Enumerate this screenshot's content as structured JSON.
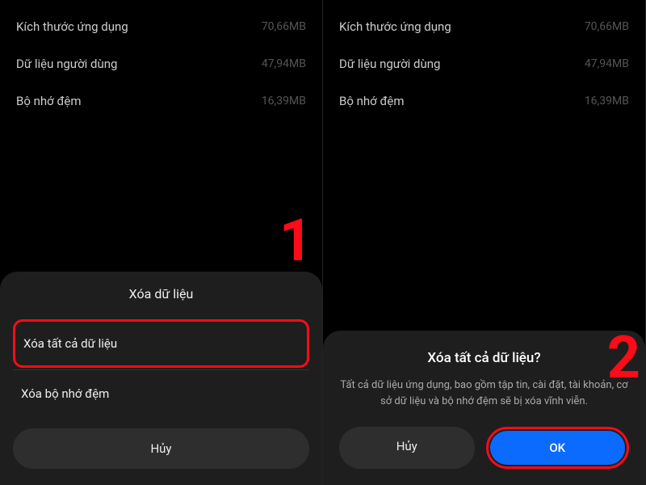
{
  "storage": {
    "rows": [
      {
        "label": "Kích thước ứng dụng",
        "value": "70,66MB"
      },
      {
        "label": "Dữ liệu người dùng",
        "value": "47,94MB"
      },
      {
        "label": "Bộ nhớ đệm",
        "value": "16,39MB"
      }
    ]
  },
  "pane1": {
    "sheet_title": "Xóa dữ liệu",
    "option_clear_all": "Xóa tất cả dữ liệu",
    "option_clear_cache": "Xóa bộ nhớ đệm",
    "cancel": "Hủy",
    "step": "1"
  },
  "pane2": {
    "dialog_title": "Xóa tất cả dữ liệu?",
    "dialog_text": "Tất cả dữ liệu ứng dụng, bao gồm tập tin, cài đặt, tài khoản, cơ sở dữ liệu và bộ nhớ đệm sẽ bị xóa vĩnh viễn.",
    "cancel": "Hủy",
    "ok": "OK",
    "step": "2"
  }
}
